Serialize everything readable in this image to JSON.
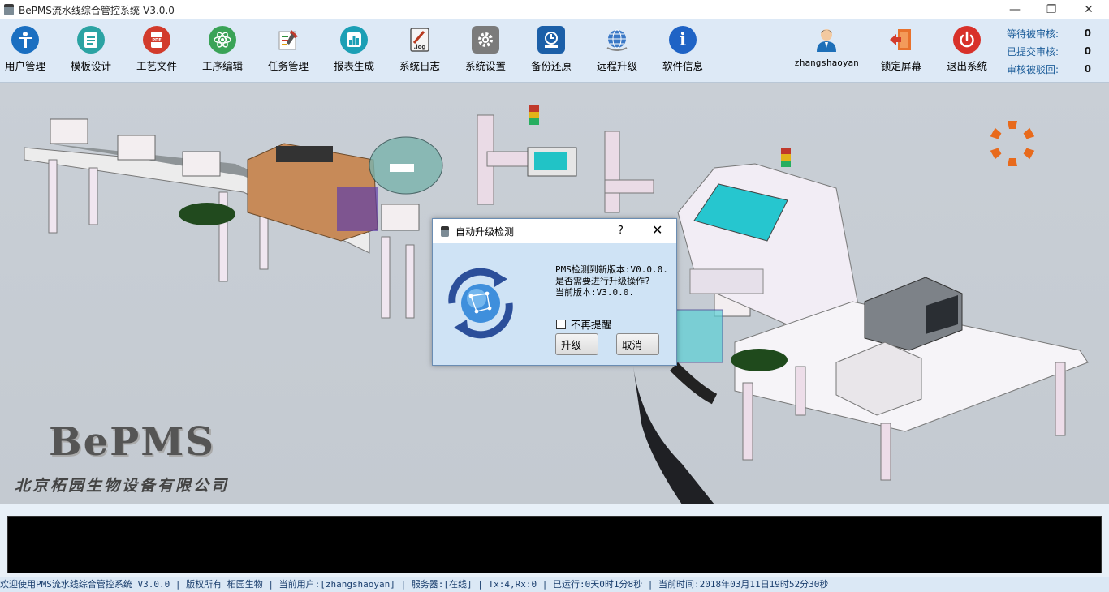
{
  "window": {
    "title": "BePMS流水线综合管控系统-V3.0.0",
    "controls": {
      "minimize": "—",
      "restore": "❐",
      "close": "✕"
    }
  },
  "toolbar": {
    "items": [
      {
        "label": "用户管理",
        "icon": "user-management-icon",
        "color": "#1a6fc1",
        "glyph": "✦"
      },
      {
        "label": "模板设计",
        "icon": "template-icon",
        "color": "#2ba3a3",
        "glyph": "▤"
      },
      {
        "label": "工艺文件",
        "icon": "pdf-icon",
        "color": "#d23b2c",
        "glyph": "PDF"
      },
      {
        "label": "工序编辑",
        "icon": "atom-icon",
        "color": "#3aa357",
        "glyph": "⚛"
      },
      {
        "label": "任务管理",
        "icon": "task-icon",
        "color": "#e4e7ea",
        "glyph": "✎"
      },
      {
        "label": "报表生成",
        "icon": "report-icon",
        "color": "#1b9fb5",
        "glyph": "▥"
      },
      {
        "label": "系统日志",
        "icon": "log-icon",
        "color": "#6b6b6b",
        "glyph": "log"
      },
      {
        "label": "系统设置",
        "icon": "gear-icon",
        "color": "#7b7b7b",
        "glyph": "⚙"
      },
      {
        "label": "备份还原",
        "icon": "backup-icon",
        "color": "#1b5fa8",
        "glyph": "⟳"
      },
      {
        "label": "远程升级",
        "icon": "globe-icon",
        "color": "#3a6fb0",
        "glyph": "◎"
      },
      {
        "label": "软件信息",
        "icon": "info-icon",
        "color": "#1f63c5",
        "glyph": "i"
      }
    ],
    "user": {
      "label": "zhangshaoyan",
      "icon": "user-avatar-icon"
    },
    "lock": {
      "label": "锁定屏幕",
      "icon": "lock-screen-icon"
    },
    "exit": {
      "label": "退出系统",
      "icon": "power-icon"
    }
  },
  "counters": [
    {
      "label": "等待被审核:",
      "value": "0"
    },
    {
      "label": "已提交审核:",
      "value": "0"
    },
    {
      "label": "审核被驳回:",
      "value": "0"
    }
  ],
  "stage": {
    "brand": "BePMS",
    "company": "北京柘园生物设备有限公司"
  },
  "dialog": {
    "title": "自动升级检测",
    "help": "?",
    "close": "✕",
    "message_line1": "PMS检测到新版本:V0.0.0.",
    "message_line2": "是否需要进行升级操作?",
    "message_line3": "当前版本:V3.0.0.",
    "checkbox_label": "不再提醒",
    "checkbox_checked": false,
    "upgrade_button": "升级",
    "cancel_button": "取消"
  },
  "statusbar": {
    "text": "欢迎使用PMS流水线综合管控系统 V3.0.0 | 版权所有 柘园生物 | 当前用户:[zhangshaoyan] | 服务器:[在线] | Tx:4,Rx:0 | 已运行:0天0时1分8秒 | 当前时间:2018年03月11日19时52分30秒"
  }
}
